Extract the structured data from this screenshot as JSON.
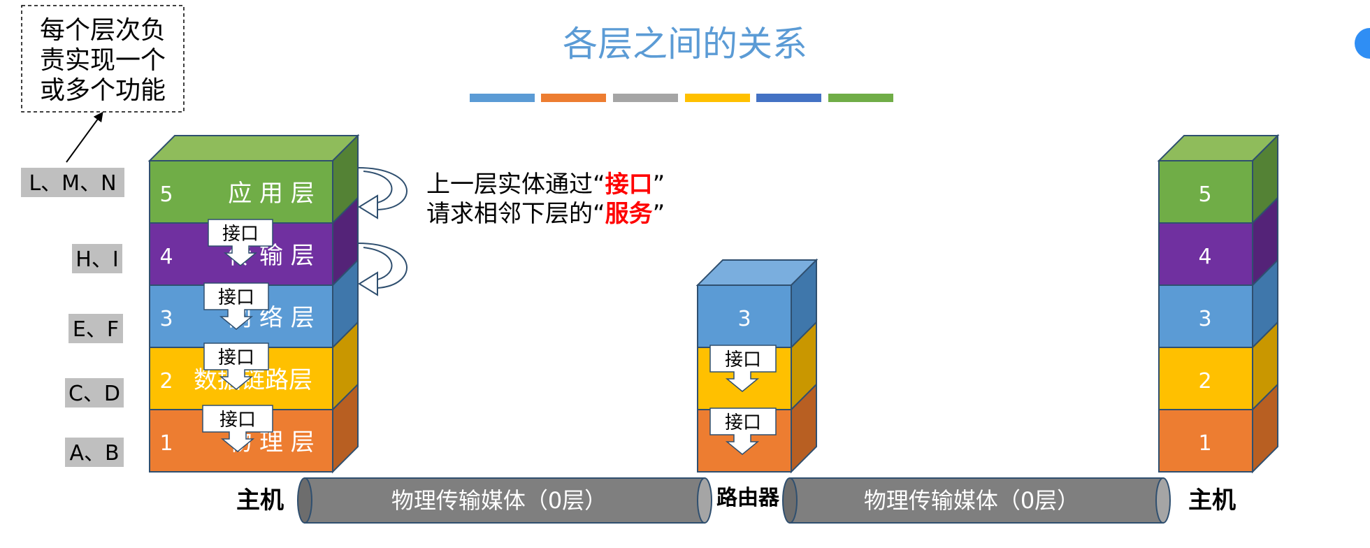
{
  "title": "各层之间的关系",
  "colors": {
    "title": "#5b9bd5",
    "bar_segments": [
      "#5b9bd5",
      "#ed7d31",
      "#a5a5a5",
      "#ffc000",
      "#4472c4",
      "#70ad47"
    ],
    "layer5": "#70ad47",
    "layer4": "#7030a0",
    "layer3": "#5b9bd5",
    "layer2": "#ffc000",
    "layer1": "#ed7d31",
    "medium": "#7f7f7f",
    "label_bg": "#bfbfbf",
    "highlight": "#ff0000"
  },
  "note_box": [
    "每个层次负",
    "责实现一个",
    "或多个功能"
  ],
  "side_labels": [
    "L、M、N",
    "H、I",
    "E、F",
    "C、D",
    "A、B"
  ],
  "host_left": {
    "label": "主机",
    "layers": [
      {
        "num": "5",
        "name": "应 用 层"
      },
      {
        "num": "4",
        "name": "传 输 层"
      },
      {
        "num": "3",
        "name": "网 络 层"
      },
      {
        "num": "2",
        "name": "数据链路层"
      },
      {
        "num": "1",
        "name": "物 理 层"
      }
    ]
  },
  "interface_label": "接口",
  "service_text": {
    "line1_prefix": "上一层实体通过“",
    "line1_key": "接口",
    "line1_suffix": "”",
    "line2_prefix": "请求相邻下层的“",
    "line2_key": "服务",
    "line2_suffix": "”"
  },
  "router": {
    "label": "路由器",
    "layers": [
      {
        "num": "3"
      },
      {
        "num": ""
      },
      {
        "num": ""
      }
    ]
  },
  "host_right": {
    "label": "主机",
    "layers": [
      {
        "num": "5"
      },
      {
        "num": "4"
      },
      {
        "num": "3"
      },
      {
        "num": "2"
      },
      {
        "num": "1"
      }
    ]
  },
  "media": [
    "物理传输媒体（0层）",
    "物理传输媒体（0层）"
  ]
}
